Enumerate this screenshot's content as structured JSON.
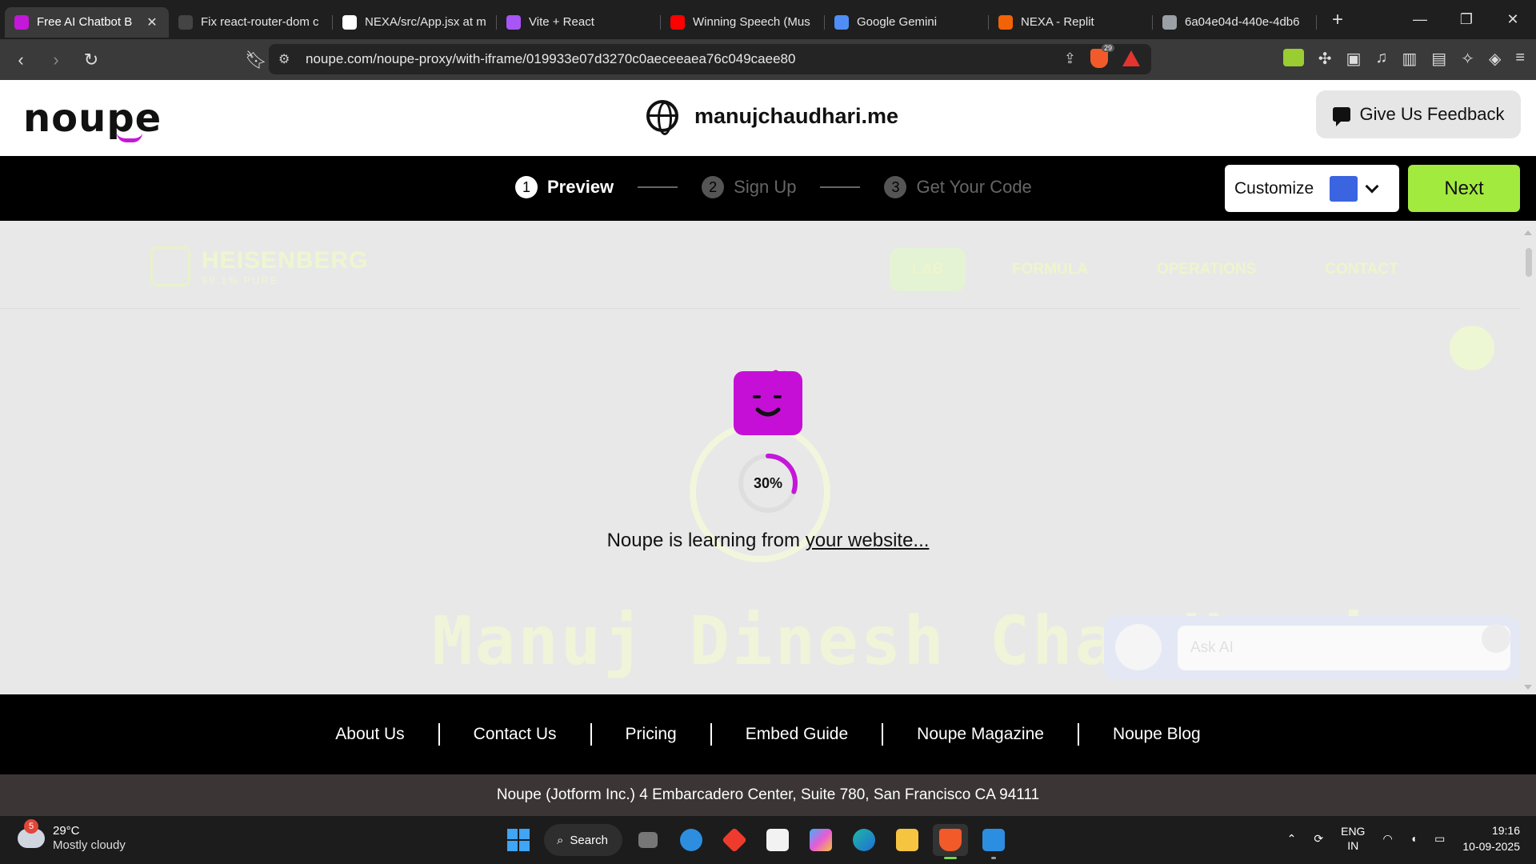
{
  "browser": {
    "tabs": [
      {
        "title": "Free AI Chatbot B",
        "favicon_color": "#c418d8",
        "active": true
      },
      {
        "title": "Fix react-router-dom c",
        "favicon_color": "#444444",
        "active": false
      },
      {
        "title": "NEXA/src/App.jsx at m",
        "favicon_color": "#ffffff",
        "active": false
      },
      {
        "title": "Vite + React",
        "favicon_color": "#a855f7",
        "active": false
      },
      {
        "title": "Winning Speech (Mus",
        "favicon_color": "#ff0000",
        "active": false
      },
      {
        "title": "Google Gemini",
        "favicon_color": "#4f8ef7",
        "active": false
      },
      {
        "title": "NEXA - Replit",
        "favicon_color": "#f26207",
        "active": false
      },
      {
        "title": "6a04e04d-440e-4db6",
        "favicon_color": "#9aa0a6",
        "active": false
      }
    ],
    "new_tab_label": "+",
    "url": "noupe.com/noupe-proxy/with-iframe/019933e07d3270c0aeceeaea76c049caee80",
    "shield_count": "29"
  },
  "header": {
    "logo_text": "noupe",
    "site_name": "manujchaudhari.me",
    "feedback_label": "Give Us Feedback"
  },
  "steps": [
    {
      "num": "1",
      "label": "Preview"
    },
    {
      "num": "2",
      "label": "Sign Up"
    },
    {
      "num": "3",
      "label": "Get Your Code"
    }
  ],
  "toolbar": {
    "customize_label": "Customize",
    "swatch_color": "#3a64e0",
    "next_label": "Next"
  },
  "preview": {
    "brand_title": "HEISENBERG",
    "brand_sub": "99.1% PURE",
    "nav": [
      "LAB",
      "FORMULA",
      "OPERATIONS",
      "CONTACT"
    ],
    "hero_name": "Manuj Dinesh Chaudhari",
    "chat_placeholder": "Ask AI",
    "progress_text": "30%",
    "progress_value": 0.3,
    "loading_prefix": "Noupe is learning from ",
    "loading_link": "your website..."
  },
  "footer": {
    "links": [
      "About Us",
      "Contact Us",
      "Pricing",
      "Embed Guide",
      "Noupe Magazine",
      "Noupe Blog"
    ],
    "address": "Noupe (Jotform Inc.) 4 Embarcadero Center, Suite 780, San Francisco CA 94111"
  },
  "taskbar": {
    "weather_badge": "5",
    "temp": "29°C",
    "condition": "Mostly cloudy",
    "search_label": "Search",
    "lang_1": "ENG",
    "lang_2": "IN",
    "time": "19:16",
    "date": "10-09-2025"
  }
}
